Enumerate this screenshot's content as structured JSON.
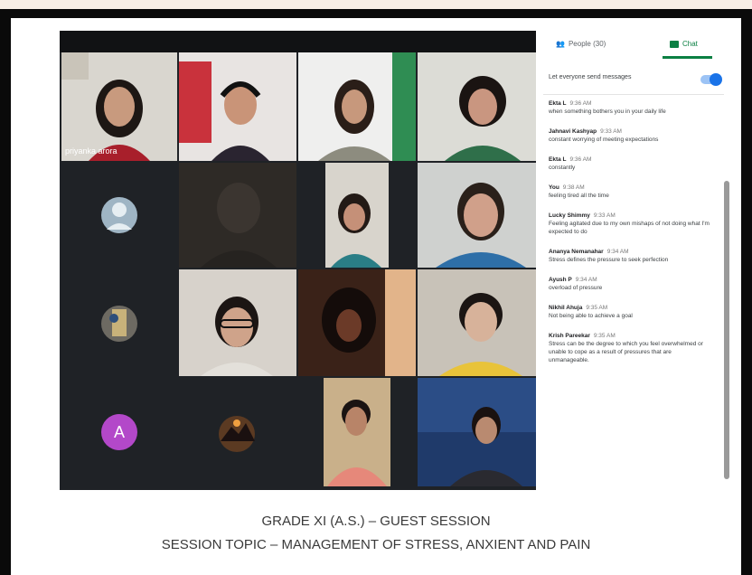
{
  "meet": {
    "tabs": {
      "people_label": "People (30)",
      "chat_label": "Chat"
    },
    "chat_setting_label": "Let everyone send messages",
    "participants": [
      {
        "name": "priyanka arora"
      }
    ],
    "avatar_letter": "A",
    "messages": [
      {
        "sender": "Ekta L",
        "time": "9:36 AM",
        "text": "when something bothers you in your daily life"
      },
      {
        "sender": "Jahnavi Kashyap",
        "time": "9:33 AM",
        "text": "constant worrying of meeting expectations"
      },
      {
        "sender": "Ekta L",
        "time": "9:36 AM",
        "text": "constantly"
      },
      {
        "sender": "You",
        "time": "9:38 AM",
        "text": "feeling tired all the time"
      },
      {
        "sender": "Lucky Shimmy",
        "time": "9:33 AM",
        "text": "Feeling agitated due to my own mishaps of not doing what I'm expected to do"
      },
      {
        "sender": "Ananya Nemanahar",
        "time": "9:34 AM",
        "text": "Stress defines the pressure to seek perfection"
      },
      {
        "sender": "Ayush P",
        "time": "9:34 AM",
        "text": "overload of pressure"
      },
      {
        "sender": "Nikhil Ahuja",
        "time": "9:35 AM",
        "text": "Not being able to achieve a goal"
      },
      {
        "sender": "Krish Pareekar",
        "time": "9:35 AM",
        "text": "Stress can be the degree to which you feel overwhelmed or unable to cope as a result of pressures that are unmanageable."
      }
    ],
    "colors": {
      "accent": "#0b8043",
      "toggle": "#1a73e8",
      "avatar": "#b348c9"
    }
  },
  "caption": {
    "line1": "GRADE XI (A.S.) – GUEST SESSION",
    "line2": "SESSION TOPIC – MANAGEMENT OF STRESS, ANXIENT AND PAIN"
  }
}
